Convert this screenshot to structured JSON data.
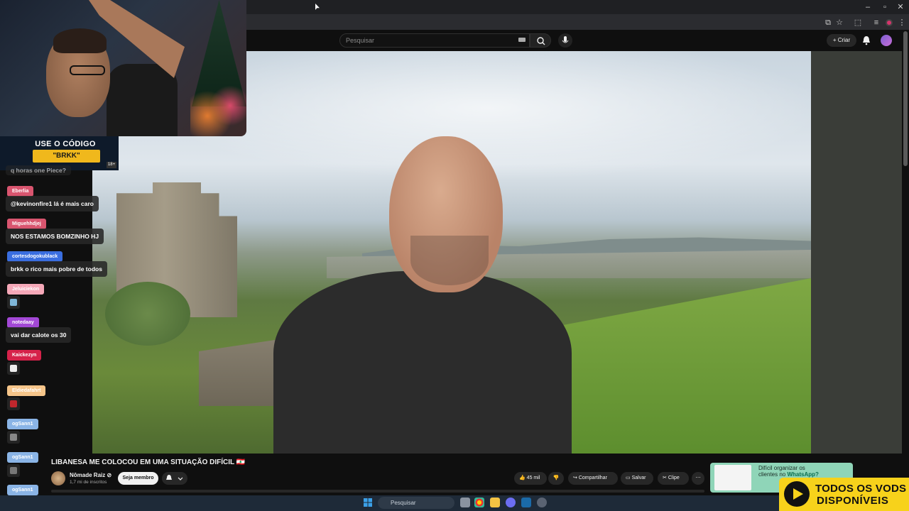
{
  "browser": {
    "title_icons": [
      "minimize-icon",
      "maximize-icon",
      "close-icon"
    ],
    "toolbar_icons": [
      "cast-icon",
      "star-icon",
      "extensions-icon",
      "profile-icon",
      "more-icon"
    ]
  },
  "youtube_header": {
    "search_placeholder": "Pesquisar",
    "create_label": "Criar"
  },
  "webcam_overlay": {
    "promo_line1": "USE O CÓDIGO",
    "promo_line2": "\"BRKK\"",
    "promo_badge": "18+"
  },
  "chat": {
    "partial_top": "q horas one Piece?",
    "messages": [
      {
        "user": "Eberlia",
        "text": "@kevinonfire1 lá é mais caro",
        "color": "#d9556f"
      },
      {
        "user": "Miguehhdjej",
        "text": "NOS ESTAMOS BOMZINHO HJ",
        "color": "#d9556f"
      },
      {
        "user": "cortesdogokublack",
        "text": "brkk o rico mais pobre de todos",
        "color": "#3a6ee0"
      },
      {
        "user": "Jeluiciekon",
        "text": "",
        "color": "#f5a8b8",
        "emote_color": "#7fb6d8"
      },
      {
        "user": "notedaay",
        "text": "vai dar calote os 30",
        "color": "#a348d6"
      },
      {
        "user": "Kaickezyn",
        "text": "",
        "color": "#d6224a",
        "emote_color": "#eeeeee"
      },
      {
        "user": "Eldiedafahrt",
        "text": "",
        "color": "#f6c58a",
        "emote_color": "#c0272d"
      },
      {
        "user": "ogSann1",
        "text": "",
        "color": "#8ab4e6",
        "emote_color": "#888888"
      },
      {
        "user": "ogSann1",
        "text": "",
        "color": "#8ab4e6",
        "emote_color": "#777777"
      },
      {
        "user": "ogSann1",
        "text": "",
        "color": "#8ab4e6",
        "emote_color": "#6a8ad8"
      }
    ]
  },
  "video": {
    "title": "LIBANESA ME COLOCOU EM UMA SITUAÇÃO DIFÍCIL 🇱🇧",
    "channel_name": "Nômade Raiz ⊘",
    "subscribers": "1,7 mi de inscritos",
    "join_label": "Seja membro",
    "likes": "45 mil",
    "share_label": "Compartilhar",
    "save_label": "Salvar",
    "clip_label": "Clipe"
  },
  "ad": {
    "line1": "Difícil organizar os",
    "line2_prefix": "clientes no ",
    "line2_highlight": "WhatsApp?"
  },
  "overlay_logo": {
    "line1": "TODOS OS VODS",
    "line2": "DISPONÍVEIS"
  },
  "taskbar": {
    "search_placeholder": "Pesquisar"
  },
  "colors": {
    "page_bg": "#0f0f0f",
    "promo_yellow": "#f0b81c",
    "vods_yellow": "#f7d21b",
    "ad_green": "#8fd5b8",
    "yt_red": "#e03030"
  }
}
